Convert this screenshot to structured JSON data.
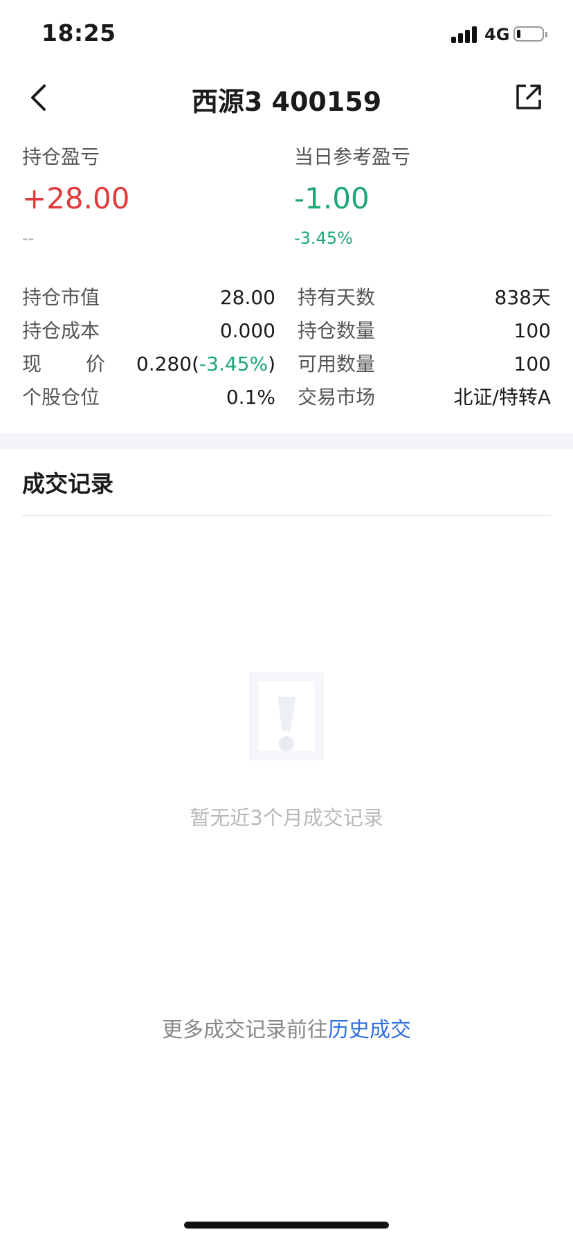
{
  "status_bar": {
    "time": "18:25",
    "network": "4G",
    "battery_fraction": 0.15
  },
  "nav": {
    "back_icon": "chevron-left-icon",
    "title": "西源3 400159",
    "share_icon": "share-out-icon"
  },
  "summary": {
    "holding_pnl_label": "持仓盈亏",
    "holding_pnl_value": "+28.00",
    "holding_pnl_sub": "--",
    "daily_pnl_label": "当日参考盈亏",
    "daily_pnl_value": "-1.00",
    "daily_pnl_pct": "-3.45%"
  },
  "details": {
    "market_value_label": "持仓市值",
    "market_value": "28.00",
    "holding_days_label": "持有天数",
    "holding_days": "838天",
    "cost_label": "持仓成本",
    "cost": "0.000",
    "quantity_label": "持仓数量",
    "quantity": "100",
    "price_label_1": "现",
    "price_label_2": "价",
    "price": "0.280",
    "price_open": "(",
    "price_change": "-3.45%",
    "price_close": ")",
    "available_label": "可用数量",
    "available": "100",
    "position_ratio_label": "个股仓位",
    "position_ratio": "0.1%",
    "market_label": "交易市场",
    "market": "北证/特转A"
  },
  "trades": {
    "title": "成交记录",
    "empty_icon": "empty-notice-icon",
    "empty_text": "暂无近3个月成交记录",
    "more_prefix": "更多成交记录前往",
    "more_link": "历史成交"
  },
  "colors": {
    "up": "#e03b3b",
    "down": "#1ea672",
    "link": "#2f6fe0"
  }
}
